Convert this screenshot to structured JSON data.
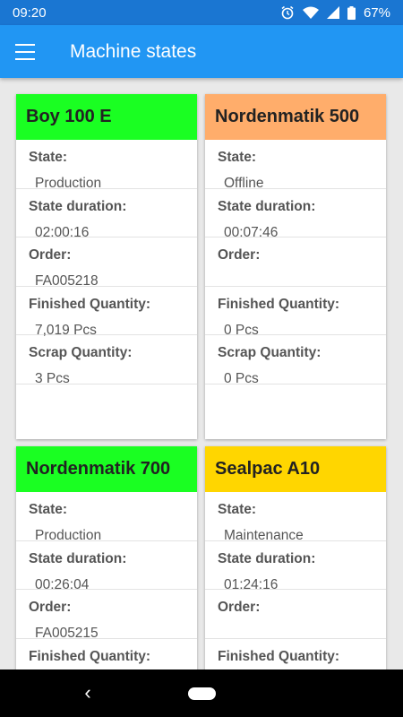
{
  "status_bar": {
    "time": "09:20",
    "battery": "67%",
    "icons": [
      "alarm-icon",
      "wifi-icon",
      "signal-icon",
      "battery-icon"
    ]
  },
  "app_bar": {
    "title": "Machine states",
    "menu_icon": "hamburger-menu-icon"
  },
  "machines": [
    {
      "name": "Boy 100 E",
      "header_color": "#1aff22",
      "fields": [
        {
          "label": "State:",
          "value": "Production"
        },
        {
          "label": "State duration:",
          "value": "02:00:16"
        },
        {
          "label": "Order:",
          "value": "FA005218"
        },
        {
          "label": "Finished Quantity:",
          "value": "7,019 Pcs"
        },
        {
          "label": "Scrap Quantity:",
          "value": "3 Pcs"
        }
      ]
    },
    {
      "name": "Nordenmatik 500",
      "header_color": "#ffad6b",
      "fields": [
        {
          "label": "State:",
          "value": "Offline"
        },
        {
          "label": "State duration:",
          "value": "00:07:46"
        },
        {
          "label": "Order:",
          "value": ""
        },
        {
          "label": "Finished Quantity:",
          "value": "0 Pcs"
        },
        {
          "label": "Scrap Quantity:",
          "value": "0 Pcs"
        }
      ]
    },
    {
      "name": "Nordenmatik 700",
      "header_color": "#1aff22",
      "fields": [
        {
          "label": "State:",
          "value": "Production"
        },
        {
          "label": "State duration:",
          "value": "00:26:04"
        },
        {
          "label": "Order:",
          "value": "FA005215"
        },
        {
          "label": "Finished Quantity:",
          "value": ""
        }
      ]
    },
    {
      "name": "Sealpac A10",
      "header_color": "#ffd600",
      "fields": [
        {
          "label": "State:",
          "value": "Maintenance"
        },
        {
          "label": "State duration:",
          "value": "01:24:16"
        },
        {
          "label": "Order:",
          "value": ""
        },
        {
          "label": "Finished Quantity:",
          "value": ""
        }
      ]
    }
  ],
  "nav_bar": {
    "back_icon": "back-chevron-icon",
    "home_icon": "home-pill-icon",
    "back_glyph": "‹"
  }
}
